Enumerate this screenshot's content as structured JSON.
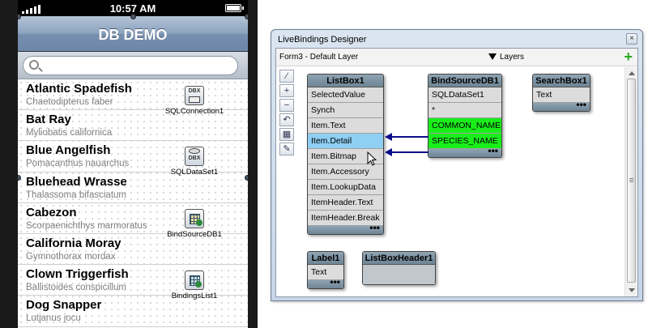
{
  "phone": {
    "status": {
      "time": "10:57 AM"
    },
    "navbar": {
      "title": "DB DEMO"
    },
    "search": {
      "placeholder": "",
      "value": ""
    },
    "list": [
      {
        "title": "Atlantic Spadefish",
        "detail": "Chaetodipterus faber"
      },
      {
        "title": "Bat Ray",
        "detail": "Myliobatis californica"
      },
      {
        "title": "Blue Angelfish",
        "detail": "Pomacanthus nauarchus"
      },
      {
        "title": "Bluehead Wrasse",
        "detail": "Thalassoma bifasciatum"
      },
      {
        "title": "Cabezon",
        "detail": "Scorpaenichthys marmoratus"
      },
      {
        "title": "California Moray",
        "detail": "Gymnothorax mordax"
      },
      {
        "title": "Clown Triggerfish",
        "detail": "Ballistoides conspicillum"
      },
      {
        "title": "Dog Snapper",
        "detail": "Lutjanus jocu"
      }
    ],
    "components": [
      {
        "name": "SQLConnection1",
        "icon": "dbx-connection-icon"
      },
      {
        "name": "SQLDataSet1",
        "icon": "dbx-dataset-icon"
      },
      {
        "name": "BindSourceDB1",
        "icon": "bind-source-icon"
      },
      {
        "name": "BindingsList1",
        "icon": "bindings-list-icon"
      }
    ]
  },
  "designer": {
    "title": "LiveBindings Designer",
    "close": "×",
    "toolbar": {
      "form_layer": "Form3  - Default Layer",
      "layers": "Layers",
      "add": "+"
    },
    "tools": [
      "⁄",
      "+",
      "−",
      "↶",
      "▦",
      "✎"
    ],
    "nodes": {
      "listbox": {
        "title": "ListBox1",
        "members": [
          "SelectedValue",
          "Synch",
          "Item.Text",
          "Item.Detail",
          "Item.Bitmap",
          "Item.Accessory",
          "Item.LookupData",
          "ItemHeader.Text",
          "ItemHeader.Break"
        ]
      },
      "bindsource": {
        "title": "BindSourceDB1",
        "members": [
          "SQLDataSet1",
          "*",
          "COMMON_NAME",
          "SPECIES_NAME"
        ]
      },
      "searchbox": {
        "title": "SearchBox1",
        "members": [
          "Text"
        ]
      },
      "label": {
        "title": "Label1",
        "members": [
          "Text"
        ]
      },
      "listboxheader": {
        "title": "ListBoxHeader1",
        "members": []
      }
    },
    "footer_dots": "•••",
    "colors": {
      "header": "#7a8f9e",
      "linked": "#1aee1a",
      "selected": "#8ecff3",
      "link_arrow": "#0d0d8a"
    }
  }
}
